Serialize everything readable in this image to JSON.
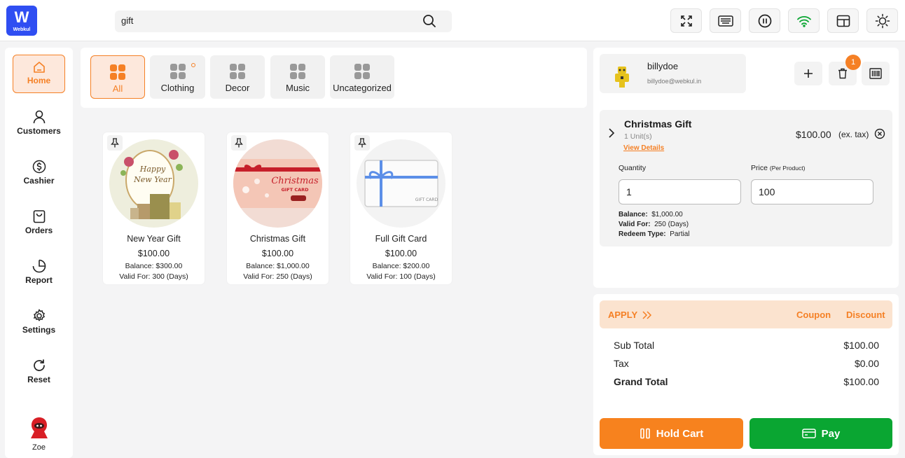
{
  "app": {
    "logo_letter": "W",
    "logo_text": "Webkul"
  },
  "search": {
    "value": "gift",
    "placeholder": ""
  },
  "colors": {
    "accent": "#f58025",
    "pay": "#0aa632",
    "brand": "#2f4ef2"
  },
  "toolbar_icons": [
    "fullscreen-icon",
    "keyboard-icon",
    "pause-icon",
    "wifi-icon",
    "window-icon",
    "sun-icon"
  ],
  "sidebar": {
    "items": [
      {
        "label": "Home",
        "icon": "home-icon"
      },
      {
        "label": "Customers",
        "icon": "user-icon"
      },
      {
        "label": "Cashier",
        "icon": "dollar-icon"
      },
      {
        "label": "Orders",
        "icon": "bag-icon"
      },
      {
        "label": "Report",
        "icon": "pie-chart-icon"
      },
      {
        "label": "Settings",
        "icon": "gear-icon"
      },
      {
        "label": "Reset",
        "icon": "refresh-icon"
      }
    ],
    "user": "Zoe"
  },
  "categories": [
    "All",
    "Clothing",
    "Decor",
    "Music",
    "Uncategorized"
  ],
  "products": [
    {
      "name": "New Year Gift",
      "price": "$100.00",
      "balance": "Balance: $300.00",
      "valid": "Valid For: 300 (Days)",
      "img_text_1": "Happy",
      "img_text_2": "New Year"
    },
    {
      "name": "Christmas Gift",
      "price": "$100.00",
      "balance": "Balance: $1,000.00",
      "valid": "Valid For: 250 (Days)",
      "img_text_1": "Christmas",
      "img_text_2": "GIFT CARD"
    },
    {
      "name": "Full Gift Card",
      "price": "$100.00",
      "balance": "Balance: $200.00",
      "valid": "Valid For: 100 (Days)",
      "img_text_1": "GIFT CARD",
      "img_text_2": ""
    }
  ],
  "customer": {
    "name": "billydoe",
    "email": "billydoe@webkul.in"
  },
  "cart_badge": "1",
  "cart_item": {
    "name": "Christmas Gift",
    "units": "1 Unit(s)",
    "link": "View Details",
    "price": "$100.00",
    "tax_note": "(ex. tax)",
    "quantity_label": "Quantity",
    "price_label": "Price",
    "price_label_small": "(Per Product)",
    "quantity": "1",
    "unit_price": "100",
    "balance_label": "Balance:",
    "balance": "$1,000.00",
    "valid_label": "Valid For:",
    "valid": "250 (Days)",
    "redeem_label": "Redeem Type:",
    "redeem": "Partial"
  },
  "apply": {
    "label": "APPLY",
    "coupon": "Coupon",
    "discount": "Discount"
  },
  "summary": {
    "subtotal_label": "Sub Total",
    "subtotal": "$100.00",
    "tax_label": "Tax",
    "tax": "$0.00",
    "grand_label": "Grand Total",
    "grand": "$100.00"
  },
  "actions": {
    "hold": "Hold Cart",
    "pay": "Pay"
  }
}
